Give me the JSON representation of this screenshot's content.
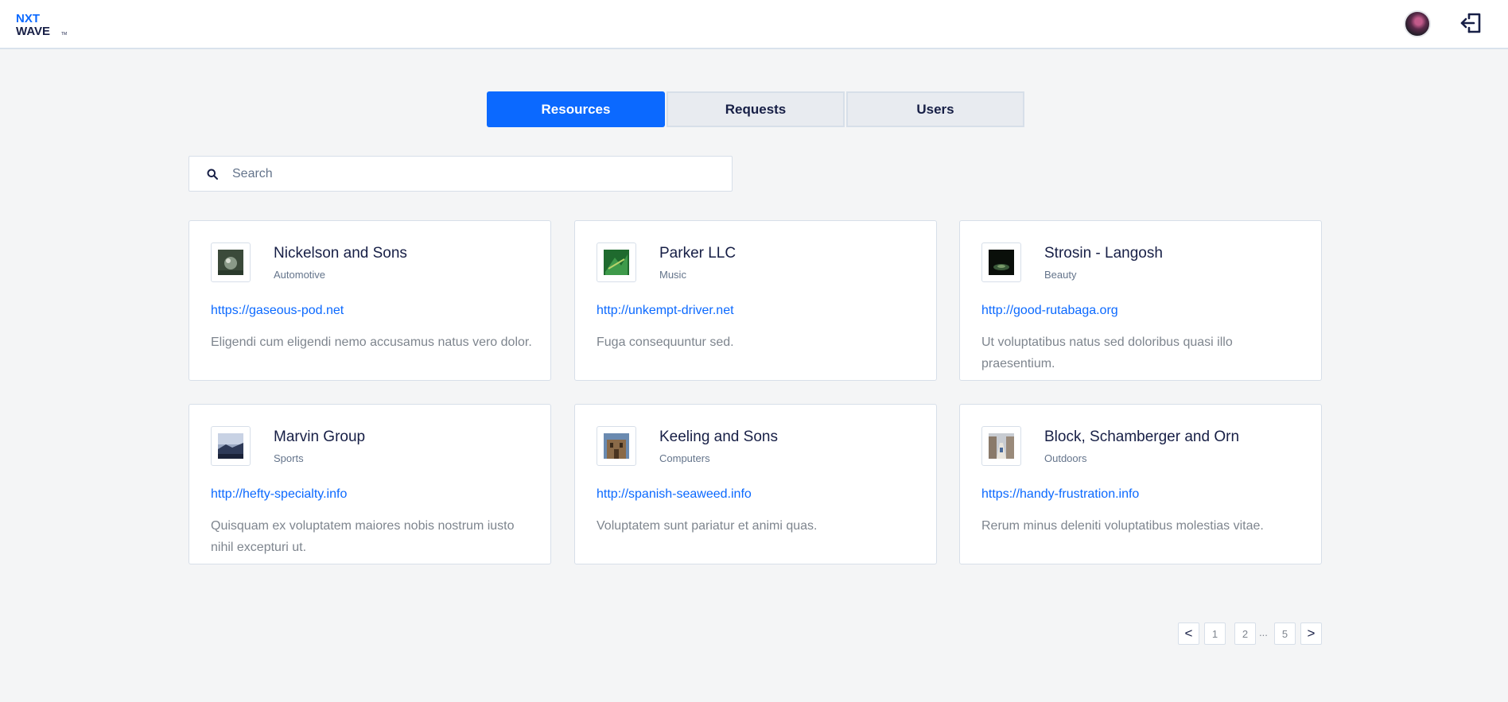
{
  "header": {
    "logo_line1": "NXT",
    "logo_line2": "WAVE",
    "logo_tm": "TM"
  },
  "tabs": [
    {
      "label": "Resources",
      "active": true
    },
    {
      "label": "Requests",
      "active": false
    },
    {
      "label": "Users",
      "active": false
    }
  ],
  "search": {
    "placeholder": "Search",
    "value": ""
  },
  "cards": [
    {
      "title": "Nickelson and Sons",
      "category": "Automotive",
      "link": "https://gaseous-pod.net",
      "description": "Eligendi cum eligendi nemo accusamus natus vero dolor."
    },
    {
      "title": "Parker LLC",
      "category": "Music",
      "link": "http://unkempt-driver.net",
      "description": "Fuga consequuntur sed."
    },
    {
      "title": "Strosin - Langosh",
      "category": "Beauty",
      "link": "http://good-rutabaga.org",
      "description": "Ut voluptatibus natus sed doloribus quasi illo praesentium."
    },
    {
      "title": "Marvin Group",
      "category": "Sports",
      "link": "http://hefty-specialty.info",
      "description": "Quisquam ex voluptatem maiores nobis nostrum iusto nihil excepturi ut."
    },
    {
      "title": "Keeling and Sons",
      "category": "Computers",
      "link": "http://spanish-seaweed.info",
      "description": "Voluptatem sunt pariatur et animi quas."
    },
    {
      "title": "Block, Schamberger and Orn",
      "category": "Outdoors",
      "link": "https://handy-frustration.info",
      "description": "Rerum minus deleniti voluptatibus molestias vitae."
    }
  ],
  "pagination": {
    "prev": "<",
    "next": ">",
    "pages": [
      "1",
      "2",
      "5"
    ],
    "ellipsis": "..."
  },
  "colors": {
    "accent": "#0b69ff",
    "title": "#171f46",
    "muted": "#7e858e",
    "background": "#f4f5f6"
  }
}
